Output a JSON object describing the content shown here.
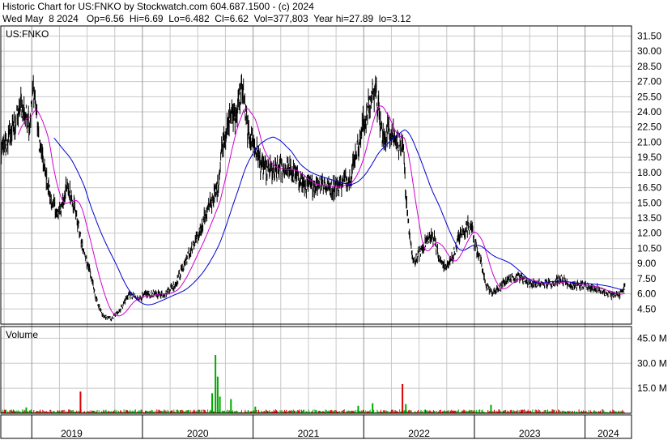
{
  "header": {
    "line1": "Historic Chart for US:FNKO by Stockwatch.com 604.687.1500 - (c) 2024",
    "line2": "Wed May  8 2024   Op=6.56  Hi=6.69  Lo=6.482  Cl=6.62  Vol=377,803  Year hi=27.89  lo=3.12"
  },
  "chart_data": {
    "type": "line",
    "symbol_label": "US:FNKO",
    "volume_label": "Volume",
    "price_ticks": [
      "31.50",
      "30.00",
      "28.50",
      "27.00",
      "25.50",
      "24.00",
      "22.50",
      "21.00",
      "19.50",
      "18.00",
      "16.50",
      "15.00",
      "13.50",
      "12.00",
      "10.50",
      "9.00",
      "7.50",
      "6.00",
      "4.50"
    ],
    "volume_ticks": [
      "45.0 M",
      "30.0 M",
      "15.0 M"
    ],
    "year_labels": [
      "2019",
      "2020",
      "2021",
      "2022",
      "2023",
      "2024"
    ],
    "price_ylim": [
      3.0,
      32.5
    ],
    "volume_ylim_millions": [
      0,
      52
    ],
    "x_range_years": [
      2018.72,
      2024.42
    ],
    "year_starts": [
      2019,
      2020,
      2021,
      2022,
      2023,
      2024
    ],
    "grid": true,
    "price_anchors": [
      [
        2018.72,
        19.8
      ],
      [
        2018.8,
        21.5
      ],
      [
        2018.9,
        24.5
      ],
      [
        2018.98,
        23.0
      ],
      [
        2019.02,
        26.5
      ],
      [
        2019.06,
        21.5
      ],
      [
        2019.12,
        18.0
      ],
      [
        2019.18,
        15.0
      ],
      [
        2019.24,
        13.8
      ],
      [
        2019.32,
        16.5
      ],
      [
        2019.38,
        15.0
      ],
      [
        2019.46,
        10.5
      ],
      [
        2019.52,
        8.5
      ],
      [
        2019.58,
        5.5
      ],
      [
        2019.64,
        3.8
      ],
      [
        2019.72,
        3.5
      ],
      [
        2019.8,
        4.5
      ],
      [
        2019.88,
        6.0
      ],
      [
        2019.95,
        5.5
      ],
      [
        2020.05,
        6.0
      ],
      [
        2020.2,
        6.0
      ],
      [
        2020.3,
        7.0
      ],
      [
        2020.4,
        9.5
      ],
      [
        2020.48,
        11.0
      ],
      [
        2020.56,
        13.5
      ],
      [
        2020.62,
        15.0
      ],
      [
        2020.68,
        16.5
      ],
      [
        2020.72,
        21.0
      ],
      [
        2020.8,
        23.5
      ],
      [
        2020.86,
        24.0
      ],
      [
        2020.9,
        26.5
      ],
      [
        2020.95,
        22.0
      ],
      [
        2021.0,
        21.0
      ],
      [
        2021.08,
        18.5
      ],
      [
        2021.2,
        18.0
      ],
      [
        2021.3,
        18.5
      ],
      [
        2021.4,
        17.5
      ],
      [
        2021.5,
        16.5
      ],
      [
        2021.6,
        17.0
      ],
      [
        2021.7,
        16.5
      ],
      [
        2021.8,
        17.0
      ],
      [
        2021.88,
        17.5
      ],
      [
        2021.92,
        19.5
      ],
      [
        2021.98,
        22.0
      ],
      [
        2022.04,
        24.5
      ],
      [
        2022.1,
        26.5
      ],
      [
        2022.14,
        23.5
      ],
      [
        2022.18,
        21.0
      ],
      [
        2022.22,
        22.5
      ],
      [
        2022.3,
        21.5
      ],
      [
        2022.36,
        20.0
      ],
      [
        2022.38,
        16.0
      ],
      [
        2022.42,
        11.0
      ],
      [
        2022.45,
        9.0
      ],
      [
        2022.5,
        10.0
      ],
      [
        2022.58,
        11.5
      ],
      [
        2022.64,
        11.5
      ],
      [
        2022.68,
        9.5
      ],
      [
        2022.74,
        8.5
      ],
      [
        2022.8,
        9.5
      ],
      [
        2022.86,
        11.5
      ],
      [
        2022.92,
        12.5
      ],
      [
        2022.97,
        13.0
      ],
      [
        2023.0,
        11.0
      ],
      [
        2023.05,
        9.5
      ],
      [
        2023.1,
        7.0
      ],
      [
        2023.16,
        6.0
      ],
      [
        2023.22,
        6.5
      ],
      [
        2023.3,
        7.5
      ],
      [
        2023.4,
        7.8
      ],
      [
        2023.5,
        7.0
      ],
      [
        2023.6,
        7.0
      ],
      [
        2023.7,
        7.0
      ],
      [
        2023.78,
        7.5
      ],
      [
        2023.88,
        6.8
      ],
      [
        2024.0,
        6.8
      ],
      [
        2024.1,
        6.5
      ],
      [
        2024.2,
        6.0
      ],
      [
        2024.3,
        5.8
      ],
      [
        2024.36,
        6.62
      ]
    ],
    "volume_spikes_millions": [
      [
        2018.95,
        3.5
      ],
      [
        2019.44,
        13.0
      ],
      [
        2020.63,
        12.0
      ],
      [
        2020.66,
        35.0
      ],
      [
        2020.68,
        22.0
      ],
      [
        2020.7,
        10.0
      ],
      [
        2020.8,
        8.5
      ],
      [
        2021.02,
        4.0
      ],
      [
        2021.95,
        4.5
      ],
      [
        2022.08,
        6.0
      ],
      [
        2022.35,
        17.5
      ],
      [
        2022.38,
        5.5
      ],
      [
        2023.15,
        5.0
      ]
    ],
    "colors": {
      "price": "#000000",
      "ma_short": "#d000d0",
      "ma_long": "#0000d0",
      "volume_up": "#00aa00",
      "volume_down": "#dd0000",
      "grid": "#c8c8c8"
    }
  }
}
